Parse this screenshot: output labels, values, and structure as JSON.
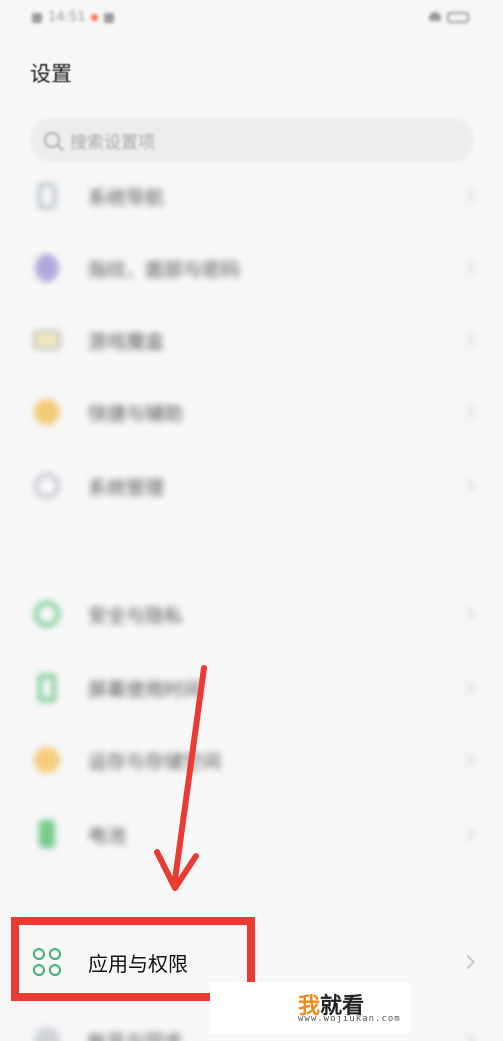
{
  "status_bar": {
    "time": "14:51"
  },
  "page": {
    "title": "设置"
  },
  "search": {
    "placeholder": "搜索设置项"
  },
  "settings_items": [
    {
      "label": "系统导航",
      "icon": "phone-icon"
    },
    {
      "label": "指纹、面部与密码",
      "icon": "fingerprint-icon"
    },
    {
      "label": "游戏魔盒",
      "icon": "game-box-icon"
    },
    {
      "label": "快捷与辅助",
      "icon": "assist-icon"
    },
    {
      "label": "系统管理",
      "icon": "system-manage-icon"
    },
    {
      "label": "安全与隐私",
      "icon": "shield-icon"
    },
    {
      "label": "屏幕使用时间",
      "icon": "screen-time-icon"
    },
    {
      "label": "运存与存储空间",
      "icon": "storage-icon"
    },
    {
      "label": "电池",
      "icon": "battery-icon"
    },
    {
      "label": "应用与权限",
      "icon": "apps-permissions-icon",
      "highlighted": true
    },
    {
      "label": "帐号与同步",
      "icon": "account-sync-icon"
    }
  ],
  "annotation": {
    "highlight_color": "#ea3b32"
  },
  "watermark": {
    "brand_accent": "我",
    "brand_rest": "就看",
    "url": "www.wojiukan.com"
  }
}
